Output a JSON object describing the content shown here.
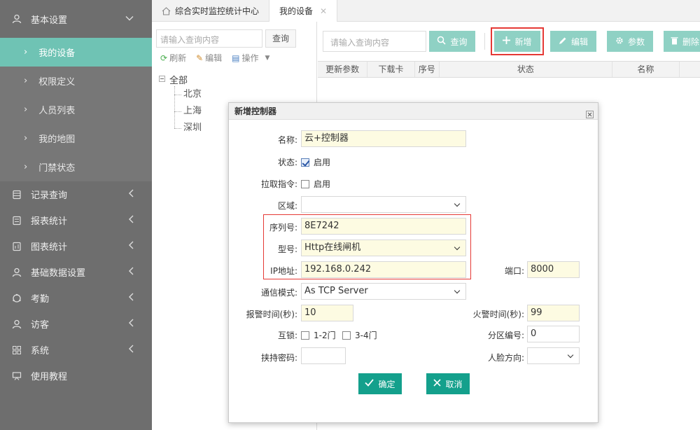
{
  "sidebar": {
    "group_basic": "基本设置",
    "subitems": [
      "我的设备",
      "权限定义",
      "人员列表",
      "我的地图",
      "门禁状态"
    ],
    "groups": [
      "记录查询",
      "报表统计",
      "图表统计",
      "基础数据设置",
      "考勤",
      "访客",
      "系统",
      "使用教程"
    ]
  },
  "tabs": {
    "home": "综合实时监控统计中心",
    "current": "我的设备",
    "close_glyph": "✕"
  },
  "tree_panel": {
    "search_placeholder": "请输入查询内容",
    "search_btn": "查询",
    "refresh": "刷新",
    "edit": "编辑",
    "ops": "操作",
    "root": "全部",
    "nodes": [
      "北京",
      "上海",
      "深圳"
    ]
  },
  "main": {
    "search_placeholder": "请输入查询内容",
    "query": "查询",
    "add": "新增",
    "edit": "编辑",
    "param": "参数",
    "delete": "删除",
    "columns": [
      "更新参数",
      "下载卡",
      "序号",
      "状态",
      "名称"
    ]
  },
  "dialog": {
    "title": "新增控制器",
    "name_label": "名称:",
    "name_value": "云+控制器",
    "status_label": "状态:",
    "status_option": "启用",
    "pull_label": "拉取指令:",
    "pull_option": "启用",
    "area_label": "区域:",
    "area_value": "",
    "serial_label": "序列号:",
    "serial_value": "8E7242",
    "model_label": "型号:",
    "model_value": "Http在线闸机",
    "ip_label": "IP地址:",
    "ip_value": "192.168.0.242",
    "port_label": "端口:",
    "port_value": "8000",
    "comm_label": "通信模式:",
    "comm_value": "As TCP Server",
    "alarm_label": "报警时间(秒):",
    "alarm_value": "10",
    "fire_label": "火警时间(秒):",
    "fire_value": "99",
    "interlock_label": "互锁:",
    "interlock_a": "1-2门",
    "interlock_b": "3-4门",
    "zone_label": "分区编号:",
    "zone_value": "0",
    "duress_label": "挟持密码:",
    "duress_value": "",
    "face_label": "人脸方向:",
    "face_value": "",
    "ok": "确定",
    "cancel": "取消"
  },
  "colors": {
    "accent": "#6fc3b4",
    "button": "#8fd1c4",
    "dialog_button": "#14a08c",
    "highlight": "#e53935",
    "sidebar": "#6e6e6e"
  }
}
